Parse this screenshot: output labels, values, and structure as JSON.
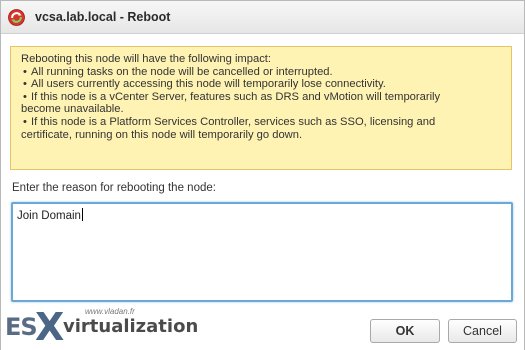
{
  "window": {
    "title": "vcsa.lab.local - Reboot",
    "icon": "reboot-icon"
  },
  "warning": {
    "lead": "Rebooting this node will have the following impact:",
    "items": [
      "All running tasks on the node will be cancelled or interrupted.",
      "All users currently accessing this node will temporarily lose connectivity.",
      "If this node is a vCenter Server, features such as DRS and vMotion will temporarily",
      "If this node is a Platform Services Controller, services such as SSO, licensing and"
    ],
    "continuations": [
      "become unavailable.",
      "certificate, running on this node will temporarily go down."
    ]
  },
  "reason": {
    "label": "Enter the reason for rebooting the node:",
    "value": "Join Domain"
  },
  "buttons": {
    "ok": "OK",
    "cancel": "Cancel"
  },
  "watermark": {
    "es": "ES",
    "x": "X",
    "brand": "virtualization",
    "site": "www.vladan.fr"
  },
  "colors": {
    "warning_bg": "#fff3b4",
    "warning_border": "#e7c36b",
    "input_focus_border": "#6aa8d8",
    "reboot_icon_red": "#d9342b",
    "reboot_icon_green": "#3aa33a"
  }
}
